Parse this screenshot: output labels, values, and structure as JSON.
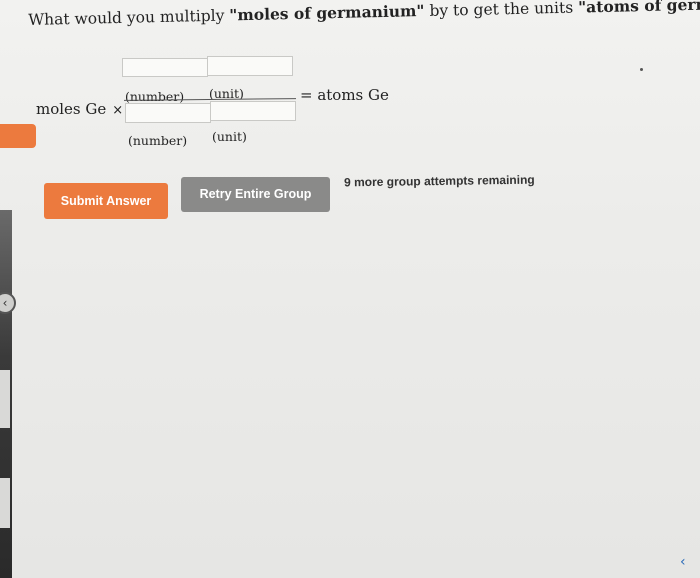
{
  "question": {
    "prefix": "What would you multiply ",
    "from_units": "\"moles of germanium\"",
    "middle": " by to get the units ",
    "to_units": "\"atoms of germanium\"",
    "suffix": "?"
  },
  "equation": {
    "lhs": "moles Ge",
    "times": "×",
    "numerator_number_label": "(number)",
    "numerator_unit_label": "(unit)",
    "denominator_number_label": "(number)",
    "denominator_unit_label": "(unit)",
    "rhs": "= atoms Ge"
  },
  "actions": {
    "submit_label": "Submit Answer",
    "retry_label": "Retry Entire Group",
    "attempts_text": "9 more group attempts remaining"
  },
  "colors": {
    "accent": "#ec7a3e",
    "retry_button": "#8a8a89"
  },
  "icons": {
    "rail_handle": "chevron-left-icon",
    "corner": "chevron-left-icon"
  }
}
